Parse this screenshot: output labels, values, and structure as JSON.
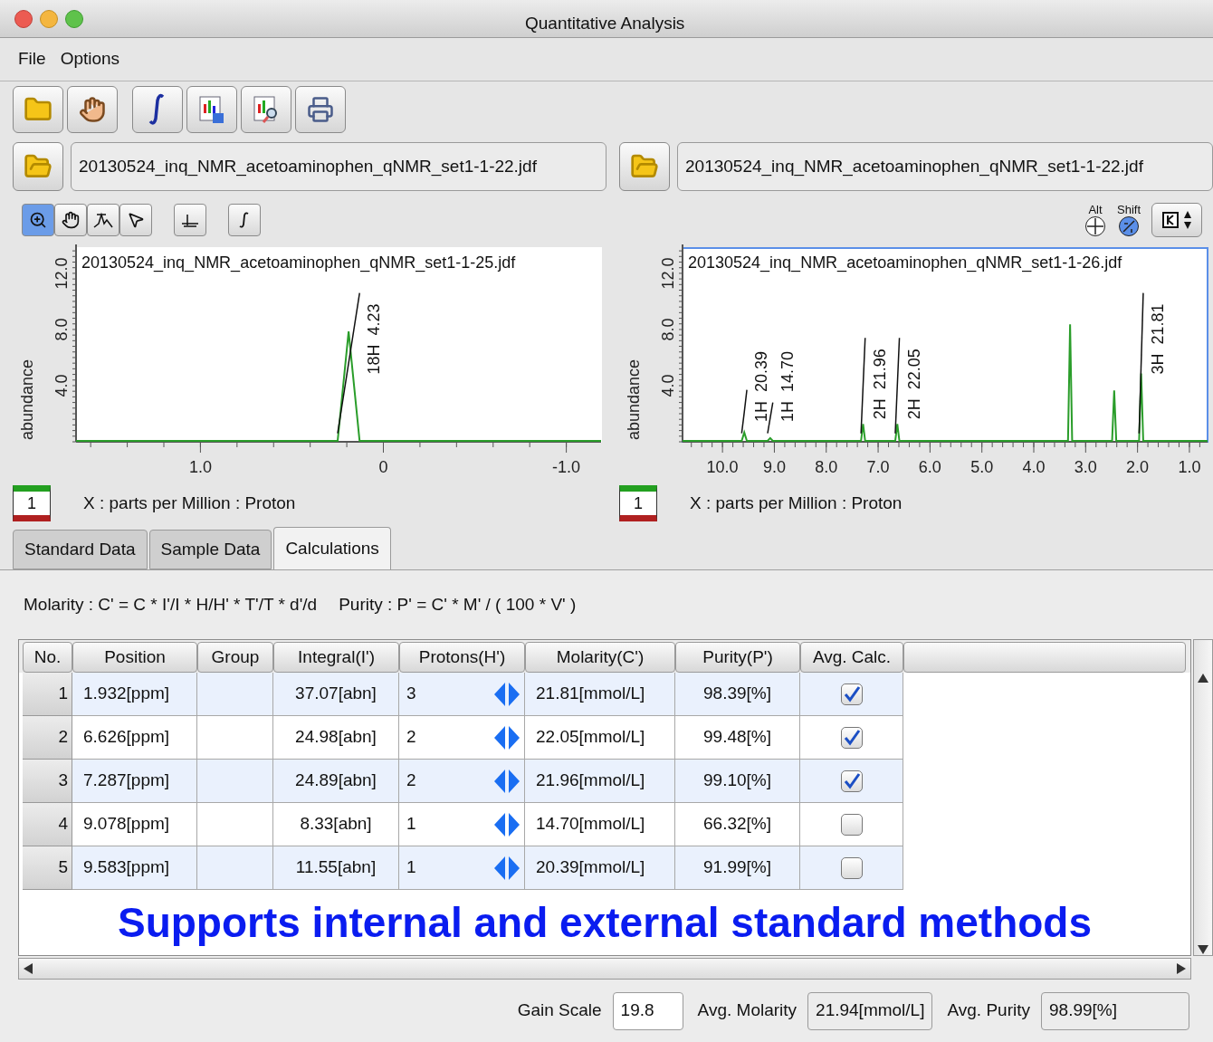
{
  "window": {
    "title": "Quantitative Analysis"
  },
  "menu": [
    "File",
    "Options"
  ],
  "panes": [
    {
      "file": "20130524_inq_NMR_acetoaminophen_qNMR_set1-1-22.jdf",
      "trace": "1",
      "selected": false,
      "chart_data": {
        "type": "line",
        "title": "20130524_inq_NMR_acetoaminophen_qNMR_set1-1-25.jdf",
        "xlabel": "X : parts per Million : Proton",
        "ylabel": "abundance",
        "xlim": [
          1.68,
          -1.19
        ],
        "ylim": [
          0,
          13.8
        ],
        "xticks": [
          {
            "value": 1,
            "label": "1.0"
          },
          {
            "value": 0,
            "label": "0"
          },
          {
            "value": -1,
            "label": "-1.0"
          }
        ],
        "yticks": [
          {
            "value": 4,
            "label": "4.0"
          },
          {
            "value": 8,
            "label": "8.0"
          },
          {
            "value": 12,
            "label": "12.0"
          }
        ],
        "x": [
          1.68,
          0.25,
          0.19,
          0.13,
          -1.19
        ],
        "series": [
          {
            "color": "#2a9d2a",
            "values": [
              0,
              0,
              7.8,
              0,
              0
            ]
          },
          {
            "color": "#111111",
            "values": [
              null,
              0.6,
              5.6,
              10.6,
              null
            ]
          }
        ],
        "annotations": [
          "18H  4.23"
        ]
      }
    },
    {
      "file": "20130524_inq_NMR_acetoaminophen_qNMR_set1-1-22.jdf",
      "trace": "1",
      "selected": true,
      "chart_data": {
        "type": "line",
        "title": "20130524_inq_NMR_acetoaminophen_qNMR_set1-1-26.jdf",
        "xlabel": "X : parts per Million : Proton",
        "ylabel": "abundance",
        "xlim": [
          10.77,
          0.65
        ],
        "ylim": [
          0,
          13.8
        ],
        "xticks": [
          {
            "value": 10,
            "label": "10.0"
          },
          {
            "value": 9,
            "label": "9.0"
          },
          {
            "value": 8,
            "label": "8.0"
          },
          {
            "value": 7,
            "label": "7.0"
          },
          {
            "value": 6,
            "label": "6.0"
          },
          {
            "value": 5,
            "label": "5.0"
          },
          {
            "value": 4,
            "label": "4.0"
          },
          {
            "value": 3,
            "label": "3.0"
          },
          {
            "value": 2,
            "label": "2.0"
          },
          {
            "value": 1,
            "label": "1.0"
          }
        ],
        "yticks": [
          {
            "value": 4,
            "label": "4.0"
          },
          {
            "value": 8,
            "label": "8.0"
          },
          {
            "value": 12,
            "label": "12.0"
          }
        ],
        "x": [
          10.77,
          9.63,
          9.58,
          9.53,
          9.35,
          9.13,
          9.08,
          9.03,
          8.0,
          7.33,
          7.29,
          7.25,
          7.0,
          6.67,
          6.63,
          6.59,
          3.34,
          3.3,
          3.26,
          2.49,
          2.45,
          2.41,
          1.97,
          1.93,
          1.89,
          0.65
        ],
        "series": [
          {
            "color": "#2a9d2a",
            "values": [
              0,
              0,
              0.6,
              0,
              0,
              0,
              0.2,
              0,
              0,
              0,
              1.2,
              0,
              0,
              0,
              1.2,
              0,
              0,
              8.3,
              0,
              0,
              3.6,
              0,
              0,
              4.8,
              0,
              0
            ]
          },
          {
            "color": "#111111",
            "values": [
              null,
              0.6,
              2.1,
              3.7,
              null,
              0.6,
              1.7,
              2.8,
              null,
              0.6,
              4,
              7.4,
              null,
              0.6,
              4,
              7.4,
              null,
              null,
              null,
              null,
              null,
              null,
              0.6,
              5.6,
              10.6,
              null
            ]
          }
        ],
        "annotations": [
          "1H  20.39",
          "1H  14.70",
          "2H  21.96",
          "2H  22.05",
          "3H  21.81"
        ]
      }
    }
  ],
  "chart_tools": [
    {
      "kind": "zoom",
      "selected": true
    },
    {
      "kind": "pan",
      "selected": false
    },
    {
      "kind": "peak",
      "selected": false
    },
    {
      "kind": "pick",
      "selected": false
    },
    {
      "kind": "baseline",
      "selected": false
    },
    {
      "kind": "integral",
      "selected": false
    }
  ],
  "modifiers": [
    "Alt",
    "Shift"
  ],
  "tabs": [
    {
      "label": "Standard Data",
      "selected": false
    },
    {
      "label": "Sample Data",
      "selected": false
    },
    {
      "label": "Calculations",
      "selected": true
    }
  ],
  "formulas": [
    "Molarity : C' = C * I'/I * H/H' * T'/T * d'/d",
    "Purity : P' = C' * M' / ( 100 * V' )"
  ],
  "table": {
    "columns": [
      "No.",
      "Position",
      "Group",
      "Integral(I')",
      "Protons(H')",
      "Molarity(C')",
      "Purity(P')",
      "Avg. Calc."
    ],
    "rows": [
      {
        "no": "1",
        "position": "1.932[ppm]",
        "integral": "37.07[abn]",
        "protons": "3",
        "molarity": "21.81[mmol/L]",
        "purity": "98.39[%]",
        "avg_calc": true
      },
      {
        "no": "2",
        "position": "6.626[ppm]",
        "integral": "24.98[abn]",
        "protons": "2",
        "molarity": "22.05[mmol/L]",
        "purity": "99.48[%]",
        "avg_calc": true
      },
      {
        "no": "3",
        "position": "7.287[ppm]",
        "integral": "24.89[abn]",
        "protons": "2",
        "molarity": "21.96[mmol/L]",
        "purity": "99.10[%]",
        "avg_calc": true
      },
      {
        "no": "4",
        "position": "9.078[ppm]",
        "integral": "8.33[abn]",
        "protons": "1",
        "molarity": "14.70[mmol/L]",
        "purity": "66.32[%]",
        "avg_calc": false
      },
      {
        "no": "5",
        "position": "9.583[ppm]",
        "integral": "11.55[abn]",
        "protons": "1",
        "molarity": "20.39[mmol/L]",
        "purity": "91.99[%]",
        "avg_calc": false
      }
    ]
  },
  "caption": "Supports internal and external standard methods",
  "footer": [
    {
      "label": "Gain Scale",
      "value": "19.8"
    },
    {
      "label": "Avg. Molarity",
      "value": "21.94[mmol/L]"
    },
    {
      "label": "Avg. Purity",
      "value": "98.99[%]"
    }
  ]
}
